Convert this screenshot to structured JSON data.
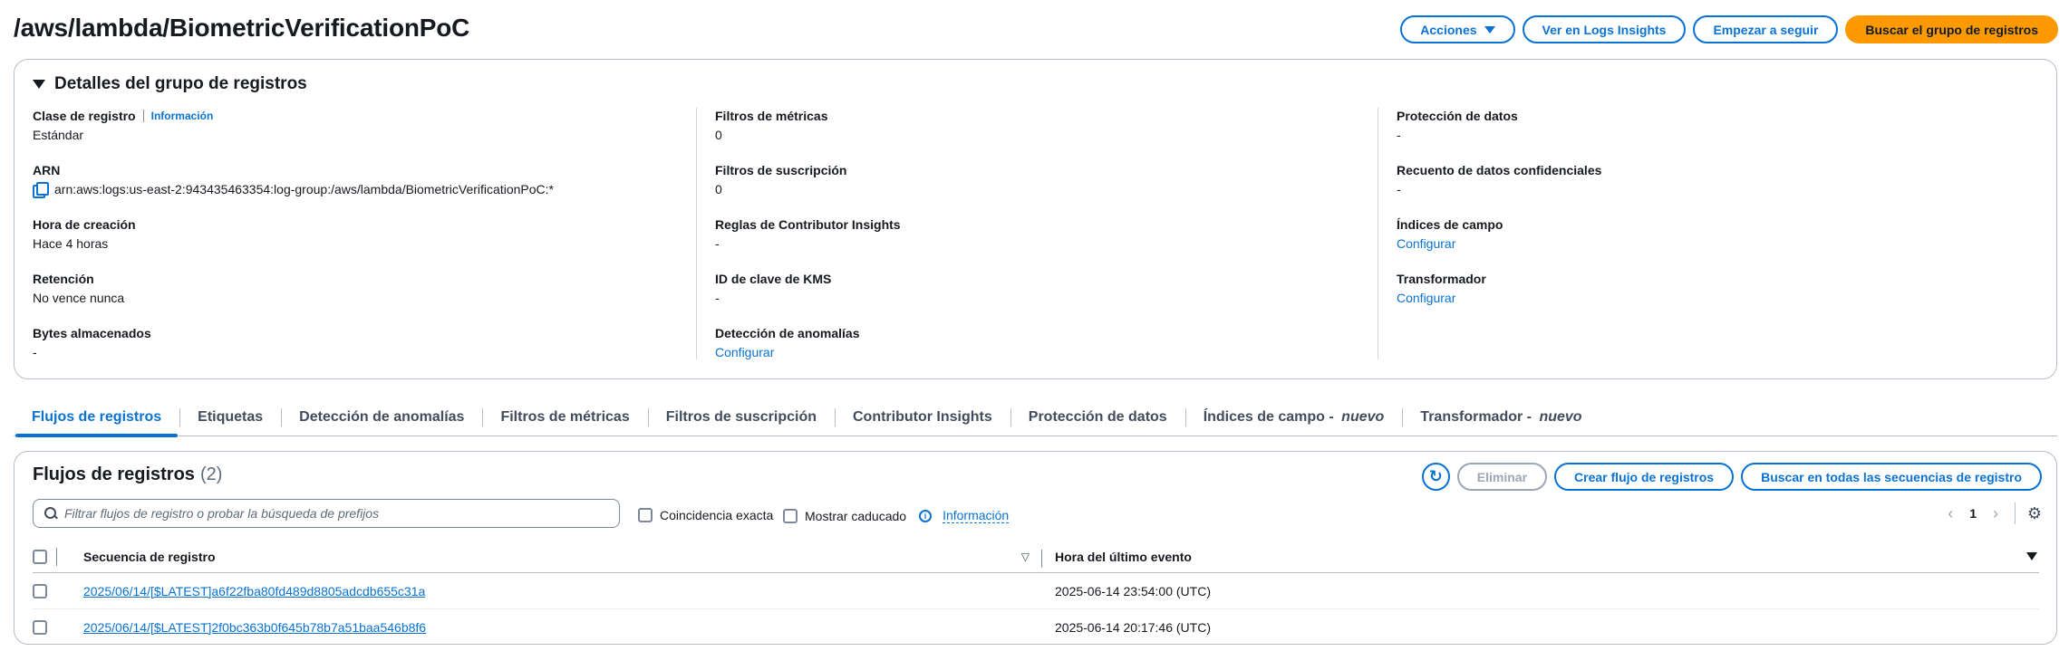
{
  "header": {
    "title": "/aws/lambda/BiometricVerificationPoC",
    "buttons": {
      "actions": "Acciones",
      "logs_insights": "Ver en Logs Insights",
      "tail": "Empezar a seguir",
      "search_group": "Buscar el grupo de registros"
    }
  },
  "details": {
    "heading": "Detalles del grupo de registros",
    "info_link": "Información",
    "col1": [
      {
        "key": "Clase de registro",
        "value": "Estándar"
      },
      {
        "key": "ARN",
        "value": "arn:aws:logs:us-east-2:943435463354:log-group:/aws/lambda/BiometricVerificationPoC:*"
      },
      {
        "key": "Hora de creación",
        "value": "Hace 4 horas"
      },
      {
        "key": "Retención",
        "value": "No vence nunca"
      },
      {
        "key": "Bytes almacenados",
        "value": "-"
      }
    ],
    "col2": [
      {
        "key": "Filtros de métricas",
        "value": "0"
      },
      {
        "key": "Filtros de suscripción",
        "value": "0"
      },
      {
        "key": "Reglas de Contributor Insights",
        "value": "-"
      },
      {
        "key": "ID de clave de KMS",
        "value": "-"
      },
      {
        "key": "Detección de anomalías",
        "value": "Configurar"
      }
    ],
    "col3": [
      {
        "key": "Protección de datos",
        "value": "-"
      },
      {
        "key": "Recuento de datos confidenciales",
        "value": "-"
      },
      {
        "key": "Índices de campo",
        "value": "Configurar"
      },
      {
        "key": "Transformador",
        "value": "Configurar"
      }
    ]
  },
  "tabs": [
    {
      "label": "Flujos de registros",
      "suffix": ""
    },
    {
      "label": "Etiquetas",
      "suffix": ""
    },
    {
      "label": "Detección de anomalías",
      "suffix": ""
    },
    {
      "label": "Filtros de métricas",
      "suffix": ""
    },
    {
      "label": "Filtros de suscripción",
      "suffix": ""
    },
    {
      "label": "Contributor Insights",
      "suffix": ""
    },
    {
      "label": "Protección de datos",
      "suffix": ""
    },
    {
      "label": "Índices de campo - ",
      "suffix": "nuevo"
    },
    {
      "label": "Transformador - ",
      "suffix": "nuevo"
    }
  ],
  "streams": {
    "title": "Flujos de registros",
    "count": "(2)",
    "buttons": {
      "delete": "Eliminar",
      "create": "Crear flujo de registros",
      "search_all": "Buscar en todas las secuencias de registro"
    },
    "search_placeholder": "Filtrar flujos de registro o probar la búsqueda de prefijos",
    "exact_match": "Coincidencia exacta",
    "show_expired": "Mostrar caducado",
    "info": "Información",
    "page": "1",
    "columns": {
      "sequence": "Secuencia de registro",
      "last_event": "Hora del último evento"
    },
    "rows": [
      {
        "sequence": "2025/06/14/[$LATEST]a6f22fba80fd489d8805adcdb655c31a",
        "time": "2025-06-14 23:54:00 (UTC)"
      },
      {
        "sequence": "2025/06/14/[$LATEST]2f0bc363b0f645b78b7a51baa546b8f6",
        "time": "2025-06-14 20:17:46 (UTC)"
      }
    ]
  },
  "colors": {
    "accent": "#0972d3",
    "primary_button": "#ff9900"
  }
}
